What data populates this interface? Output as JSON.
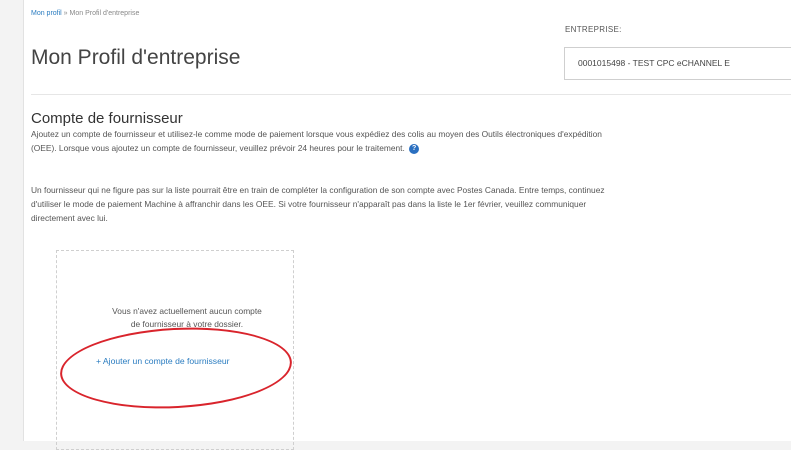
{
  "breadcrumb": {
    "link": "Mon profil",
    "separator": " » ",
    "current": "Mon Profil d'entreprise"
  },
  "page": {
    "title": "Mon Profil d'entreprise"
  },
  "entreprise": {
    "label": "ENTREPRISE:",
    "selected": "0001015498 - TEST CPC eCHANNEL E"
  },
  "section": {
    "title": "Compte de fournisseur",
    "paragraph1_line1": "Ajoutez un compte de fournisseur et utilisez-le comme mode de paiement lorsque vous expédiez des colis au moyen des Outils électroniques d'expédition",
    "paragraph1_line2": "(OEE). Lorsque vous ajoutez un compte de fournisseur, veuillez prévoir 24 heures pour le traitement.",
    "info_icon": "?",
    "paragraph2_line1": "Un fournisseur qui ne figure pas sur la liste pourrait être en train de compléter la configuration de son compte avec Postes Canada. Entre temps, continuez",
    "paragraph2_line2": "d'utiliser le mode de paiement Machine à affranchir dans les OEE. Si votre fournisseur n'apparaît pas dans la liste le 1er février, veuillez communiquer",
    "paragraph2_line3": "directement avec lui."
  },
  "empty_state": {
    "line1": "Vous n'avez actuellement aucun compte",
    "line2": "de fournisseur à votre dossier.",
    "add_link": "+ Ajouter un compte de fournisseur"
  },
  "annotation_color": "#d9242c"
}
